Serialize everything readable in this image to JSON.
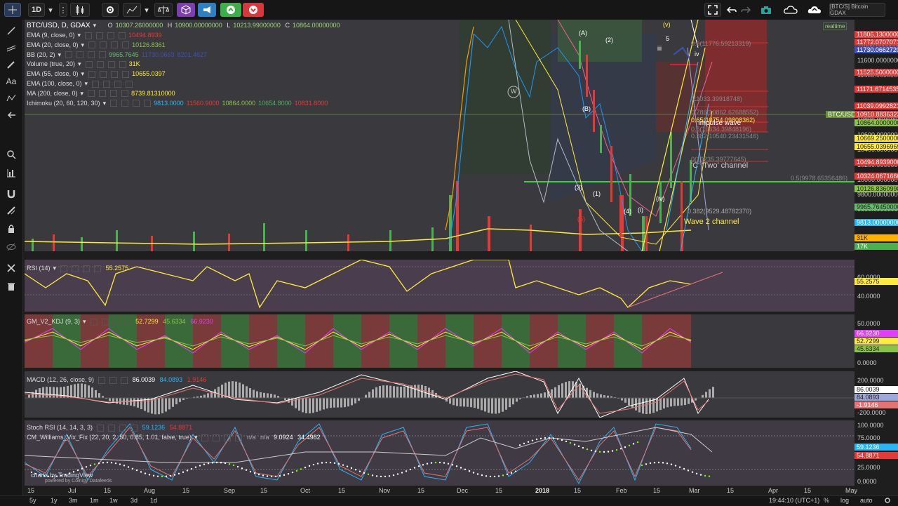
{
  "toolbar": {
    "interval": "1D",
    "symbol_badge": "[BTC/S] Bitcoin GDAX"
  },
  "main": {
    "title": "BTC/USD, D, GDAX",
    "ohlc": {
      "o_label": "O",
      "o": "10307.26000000",
      "h_label": "H",
      "h": "10900.00000000",
      "l_label": "L",
      "l": "10213.99000000",
      "c_label": "C",
      "c": "10864.00000000"
    },
    "realtime": "realtime",
    "indicators": [
      {
        "label": "EMA (9, close, 0)",
        "values": [
          "10494.8939"
        ],
        "colors": [
          "#e53935"
        ]
      },
      {
        "label": "EMA (20, close, 0)",
        "values": [
          "10126.8361"
        ],
        "colors": [
          "#8bc34a"
        ]
      },
      {
        "label": "BB (20, 2)",
        "values": [
          "9965.7645",
          "11730.0663",
          "8201.4627"
        ],
        "colors": [
          "#66bb6a",
          "#3f51b5",
          "#3f51b5"
        ]
      },
      {
        "label": "Volume (true, 20)",
        "values": [
          "31K"
        ],
        "colors": [
          "#ffeb3b"
        ]
      },
      {
        "label": "EMA (55, close, 0)",
        "values": [
          "10655.0397"
        ],
        "colors": [
          "#ffeb3b"
        ]
      },
      {
        "label": "EMA (100, close, 0)",
        "values": [],
        "colors": []
      },
      {
        "label": "MA (200, close, 0)",
        "values": [
          "8739.81310000"
        ],
        "colors": [
          "#ffeb3b"
        ]
      },
      {
        "label": "Ichimoku (20, 60, 120, 30)",
        "values": [
          "9813.0000",
          "11560.9000",
          "10864.0000",
          "10654.8000",
          "10831.8000"
        ],
        "colors": [
          "#29b6f6",
          "#e53935",
          "#8bc34a",
          "#4caf50",
          "#e53935"
        ]
      }
    ],
    "price_ticks": [
      "11800.00000000",
      "11600.00000000",
      "11400.00000000",
      "11200.00000000",
      "11000.00000000",
      "10800.00000000",
      "10600.00000000",
      "10400.00000000",
      "10200.00000000",
      "10000.00000000",
      "9800.00000000",
      "9600.00000000",
      "9400.00000000",
      "9200.00000000"
    ],
    "price_badges": [
      {
        "text": "11806.13000000",
        "color": "#e53935"
      },
      {
        "text": "11772.07070713",
        "color": "#e53935"
      },
      {
        "text": "11730.06627207",
        "color": "#3f51b5"
      },
      {
        "text": "11525.50000000",
        "color": "#e53935"
      },
      {
        "text": "11171.67145357",
        "color": "#e53935"
      },
      {
        "text": "11039.09928211",
        "color": "#e53935"
      },
      {
        "text": "10910.88363231",
        "color": "#e53935"
      },
      {
        "text": "10864.00000000",
        "color": "#8bc34a"
      },
      {
        "text": "10669.25000000",
        "color": "#ffeb3b"
      },
      {
        "text": "10655.03969695",
        "color": "#ffeb3b"
      },
      {
        "text": "10494.89390000",
        "color": "#e53935"
      },
      {
        "text": "10324.06716664",
        "color": "#e53935"
      },
      {
        "text": "10126.83609985",
        "color": "#8bc34a"
      },
      {
        "text": "9965.76450000",
        "color": "#66bb6a"
      },
      {
        "text": "9813.00000000",
        "color": "#29b6f6"
      },
      {
        "text": "31K",
        "color": "#ffb300"
      },
      {
        "text": "17K",
        "color": "#4caf50"
      }
    ],
    "btc_label": "BTC/USD",
    "annotations": [
      {
        "text": "0.5(11776.59213319)",
        "color": "#888"
      },
      {
        "text": "(11033.39918748)",
        "color": "#888"
      },
      {
        "text": "0.786(10862.62688552)",
        "color": "#888"
      },
      {
        "text": "0.65(10754.09808362)",
        "color": "#ffeb3b"
      },
      {
        "text": "0.5(10634.39848196)",
        "color": "#888"
      },
      {
        "text": "0.382(10540.23431546)",
        "color": "#888"
      },
      {
        "text": "0(10235.39777645)",
        "color": "#888"
      },
      {
        "text": "0.5(9978.65356486)",
        "color": "#888"
      },
      {
        "text": "0.382(9529.48782370)",
        "color": "#aaa"
      },
      {
        "text": "Impulse wave",
        "color": "#fff"
      },
      {
        "text": "'C' 'Two' channel",
        "color": "#ccc"
      },
      {
        "text": "Wave 2 channel",
        "color": "#ffeb3b"
      }
    ],
    "wave_labels": [
      "W",
      "(A)",
      "(B)",
      "(2)",
      "(3)",
      "(1)",
      "(4)",
      "(5)",
      "(i)",
      "(iv)",
      "(v)",
      "iii",
      "iv",
      "5"
    ]
  },
  "rsi": {
    "label": "RSI (14)",
    "value": "55.2575",
    "ticks": [
      "60.0000",
      "40.0000"
    ],
    "badge": "55.2575"
  },
  "kdj": {
    "label": "GM_V2_KDJ (9, 3)",
    "values": [
      "52.7299",
      "45.6334",
      "66.9230"
    ],
    "colors": [
      "#ffeb3b",
      "#8bc34a",
      "#e040fb"
    ],
    "badges": [
      "66.9230",
      "52.7299",
      "45.6334"
    ],
    "ticks": [
      "50.0000",
      "0.0000"
    ]
  },
  "macd": {
    "label": "MACD (12, 26, close, 9)",
    "values": [
      "86.0039",
      "84.0893",
      "1.9146"
    ],
    "colors": [
      "#ffffff",
      "#29b6f6",
      "#e53935"
    ],
    "badges": [
      "86.0039",
      "84.0893",
      "-1.9146"
    ],
    "ticks": [
      "200.0000",
      "-200.0000"
    ]
  },
  "stoch": {
    "label": "Stoch RSI (14, 14, 3, 3)",
    "values": [
      "59.1236",
      "54.8871"
    ],
    "colors": [
      "#29b6f6",
      "#e53935"
    ],
    "label2": "CM_Williams_Vix_Fix (22, 20, 2, 50, 0.85, 1.01, false, true)",
    "values2": [
      "n/a",
      "n/a",
      "9.0924",
      "34.4982"
    ],
    "badges": [
      "59.1236",
      "54.8871"
    ],
    "ticks": [
      "100.0000",
      "75.0000",
      "25.0000",
      "0.0000"
    ]
  },
  "time_axis": [
    {
      "t": "15",
      "b": false
    },
    {
      "t": "Jul",
      "b": false
    },
    {
      "t": "15",
      "b": false
    },
    {
      "t": "Aug",
      "b": false
    },
    {
      "t": "15",
      "b": false
    },
    {
      "t": "Sep",
      "b": false
    },
    {
      "t": "15",
      "b": false
    },
    {
      "t": "Oct",
      "b": false
    },
    {
      "t": "15",
      "b": false
    },
    {
      "t": "Nov",
      "b": false
    },
    {
      "t": "15",
      "b": false
    },
    {
      "t": "Dec",
      "b": false
    },
    {
      "t": "15",
      "b": false
    },
    {
      "t": "2018",
      "b": true
    },
    {
      "t": "15",
      "b": false
    },
    {
      "t": "Feb",
      "b": false
    },
    {
      "t": "15",
      "b": false
    },
    {
      "t": "Mar",
      "b": false
    },
    {
      "t": "15",
      "b": false
    },
    {
      "t": "Apr",
      "b": false
    },
    {
      "t": "15",
      "b": false
    },
    {
      "t": "May",
      "b": false
    }
  ],
  "bottom": {
    "ranges": [
      "5y",
      "1y",
      "3m",
      "1m",
      "1w",
      "3d",
      "1d"
    ],
    "clock": "19:44:10 (UTC+1)",
    "percent": "%",
    "log": "log",
    "auto": "auto"
  },
  "watermark": {
    "line1": "charts by TradingView",
    "line2": "powered by Coinigy Datafeeds"
  }
}
